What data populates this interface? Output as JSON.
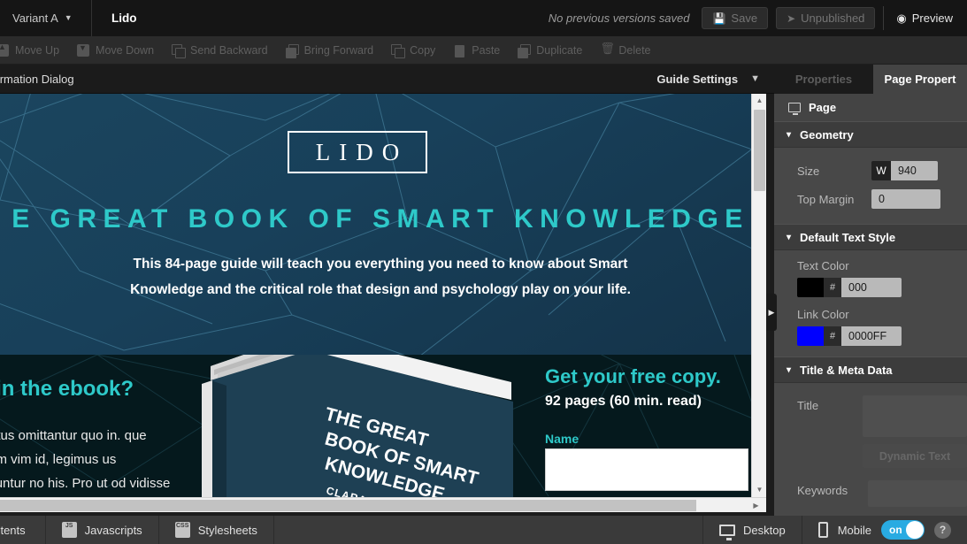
{
  "topbar": {
    "variant_label": "Variant A",
    "variant_caret": "▼",
    "page_name": "Lido",
    "version_note": "No previous versions saved",
    "save_label": "Save",
    "save_icon": "floppy-disk-icon",
    "publish_label": "Unpublished",
    "publish_icon": "paper-plane-icon",
    "preview_label": "Preview",
    "preview_icon": "eye-icon"
  },
  "actionbar": {
    "items": [
      {
        "label": "Move Up",
        "icon": "move-up-icon"
      },
      {
        "label": "Move Down",
        "icon": "move-down-icon"
      },
      {
        "label": "Send Backward",
        "icon": "send-backward-icon"
      },
      {
        "label": "Bring Forward",
        "icon": "bring-forward-icon"
      },
      {
        "label": "Copy",
        "icon": "copy-icon"
      },
      {
        "label": "Paste",
        "icon": "paste-icon"
      },
      {
        "label": "Duplicate",
        "icon": "duplicate-icon"
      },
      {
        "label": "Delete",
        "icon": "trash-icon"
      }
    ]
  },
  "subbar": {
    "dialog_label": "nfirmation Dialog",
    "guide_settings_label": "Guide Settings",
    "guide_caret": "▼"
  },
  "canvas": {
    "logo": "LIDO",
    "headline": "E GREAT BOOK OF SMART KNOWLEDGE",
    "subhead_line1": "This 84-page guide will teach you everything you need to know about Smart",
    "subhead_line2": "Knowledge   and the critical role that design and psychology play on your life.",
    "ebook_question": "at's in the ebook?",
    "lorem_text": "pit probatus omittantur quo in. que scriptorem vim id, legimus us consequuntur no his.   Pro ut od vidisse fierent, lorem",
    "book_title_line1": "THE GREAT",
    "book_title_line2": "BOOK OF SMART",
    "book_title_line3": "KNOWLEDGE",
    "book_author": "CLARA PARKER",
    "free_copy": "Get your free copy.",
    "pages_note": "92 pages (60 min. read)",
    "name_label": "Name",
    "hero_bg": "#18405a",
    "lower_bg": "#05191d",
    "accent": "#2ec9c9",
    "scroll_up": "▲",
    "scroll_down": "▼",
    "scroll_right": "▶",
    "panel_handle": "▶"
  },
  "rpanel": {
    "tab_properties": "Properties",
    "tab_page_properties": "Page Propert",
    "page_row": "Page",
    "page_icon": "monitor-icon",
    "sections": {
      "geometry": {
        "title": "Geometry",
        "chevron": "⌄",
        "size_label": "Size",
        "size_unit": "W",
        "size_value": "940",
        "top_margin_label": "Top Margin",
        "top_margin_value": "0"
      },
      "text_style": {
        "title": "Default Text Style",
        "chevron": "⌄",
        "text_color_label": "Text Color",
        "text_color_hash": "#",
        "text_color_value": "000",
        "text_color_swatch": "#000000",
        "link_color_label": "Link Color",
        "link_color_hash": "#",
        "link_color_value": "0000FF",
        "link_color_swatch": "#0000FF"
      },
      "meta": {
        "title": "Title & Meta Data",
        "chevron": "⌄",
        "title_label": "Title",
        "title_value": "",
        "dynamic_text_label": "Dynamic Text",
        "keywords_label": "Keywords"
      }
    }
  },
  "bottombar": {
    "contents_label": "ontents",
    "javascripts_label": "Javascripts",
    "javascripts_icon": "js-file-icon",
    "javascripts_badge": "JS",
    "stylesheets_label": "Stylesheets",
    "stylesheets_icon": "css-file-icon",
    "stylesheets_badge": "CSS",
    "desktop_label": "Desktop",
    "desktop_icon": "monitor-icon",
    "mobile_label": "Mobile",
    "mobile_icon": "phone-icon",
    "toggle_state": "on",
    "help_label": "?",
    "toggle_color": "#29abe2"
  }
}
